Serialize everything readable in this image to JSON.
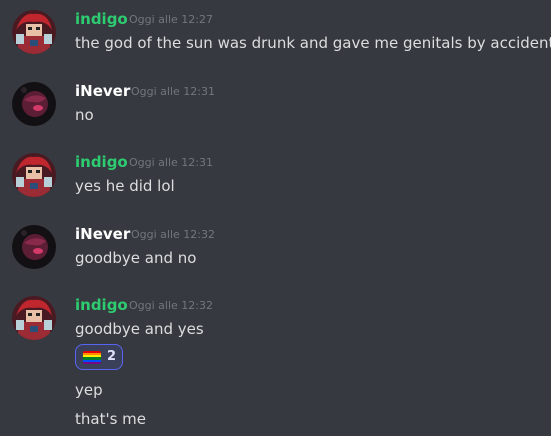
{
  "colors": {
    "background": "#36393f",
    "indigo_name": "#2ecc71",
    "inever_name": "#ffffff",
    "timestamp": "#72767d",
    "message_text": "#dcddde",
    "reaction_border": "#5865f2"
  },
  "messages": [
    {
      "author": "indigo",
      "timestamp": "Oggi alle 12:27",
      "lines": [
        "the god of the sun was drunk and gave me genitals by accident"
      ]
    },
    {
      "author": "iNever",
      "timestamp": "Oggi alle 12:31",
      "lines": [
        "no"
      ]
    },
    {
      "author": "indigo",
      "timestamp": "Oggi alle 12:31",
      "lines": [
        "yes he did lol"
      ]
    },
    {
      "author": "iNever",
      "timestamp": "Oggi alle 12:32",
      "lines": [
        "goodbye and no"
      ]
    },
    {
      "author": "indigo",
      "timestamp": "Oggi alle 12:32",
      "lines": [
        "goodbye and yes"
      ],
      "reaction": {
        "emoji": "rainbow-flag-icon",
        "count": "2"
      }
    }
  ],
  "followups": [
    "yep",
    "that's me"
  ]
}
